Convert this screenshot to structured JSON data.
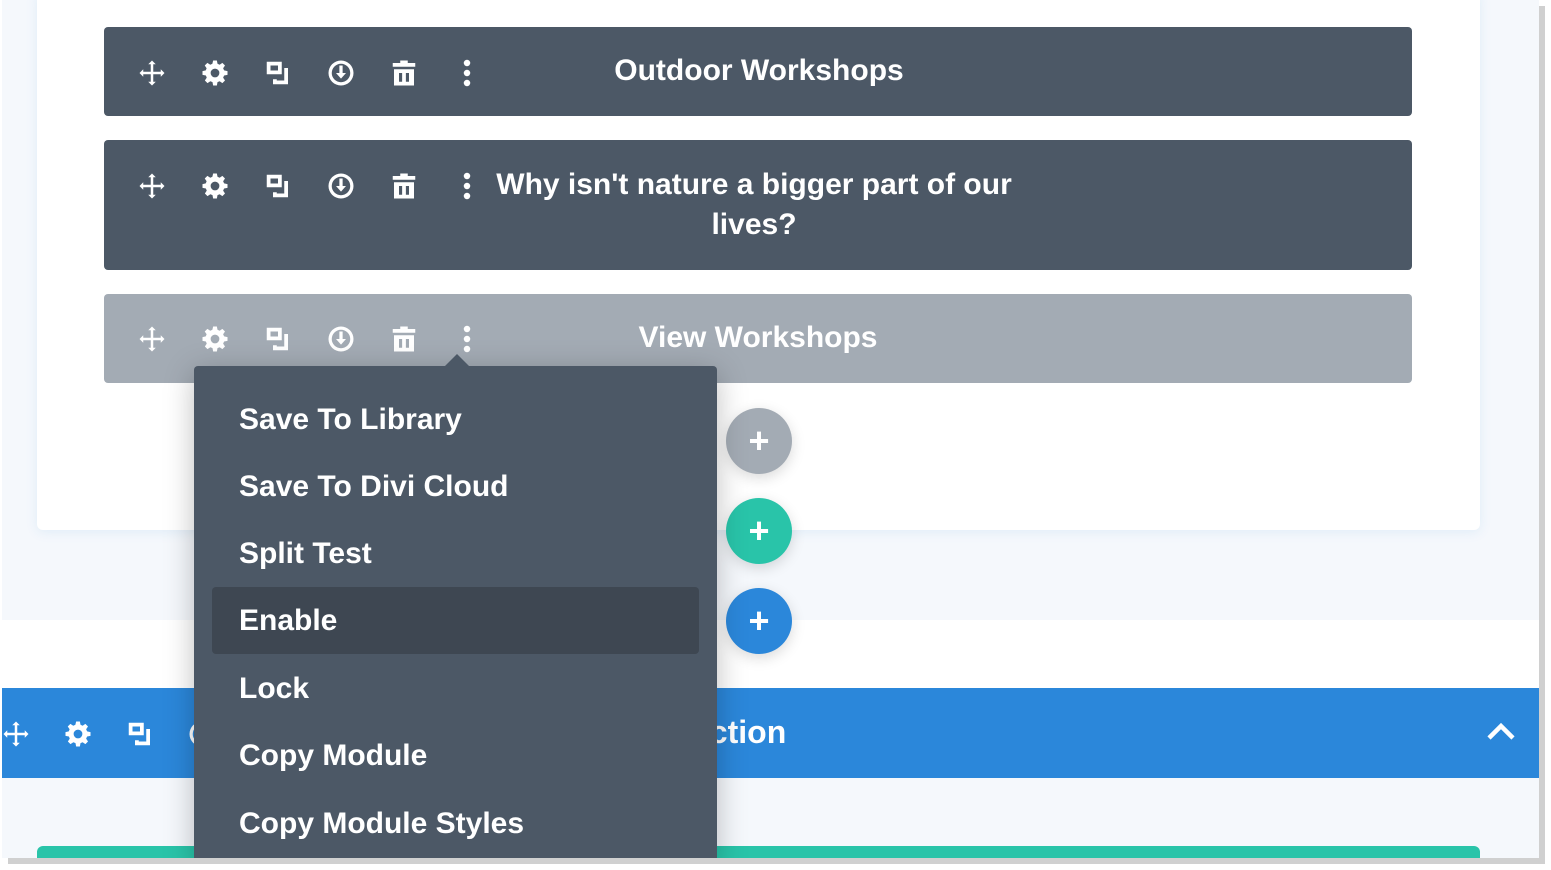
{
  "modules": [
    {
      "title": "Outdoor Workshops"
    },
    {
      "title": "Why isn't nature a bigger part of our lives?"
    },
    {
      "title": "View Workshops"
    }
  ],
  "toolbar_icons": [
    "move-icon",
    "settings-icon",
    "duplicate-icon",
    "save-icon",
    "delete-icon",
    "more-options-icon"
  ],
  "context_menu": {
    "items": [
      {
        "label": "Save To Library"
      },
      {
        "label": "Save To Divi Cloud"
      },
      {
        "label": "Split Test"
      },
      {
        "label": "Enable",
        "highlighted": true
      },
      {
        "label": "Lock"
      },
      {
        "label": "Copy Module"
      },
      {
        "label": "Copy Module Styles"
      }
    ]
  },
  "add_buttons": {
    "module_symbol": "+",
    "row_symbol": "+",
    "section_symbol": "+"
  },
  "section": {
    "title_visible": "ection"
  },
  "colors": {
    "module_bg": "#4c5866",
    "module_hover_bg": "#a3abb4",
    "teal": "#29c4a9",
    "blue": "#2b87da"
  }
}
